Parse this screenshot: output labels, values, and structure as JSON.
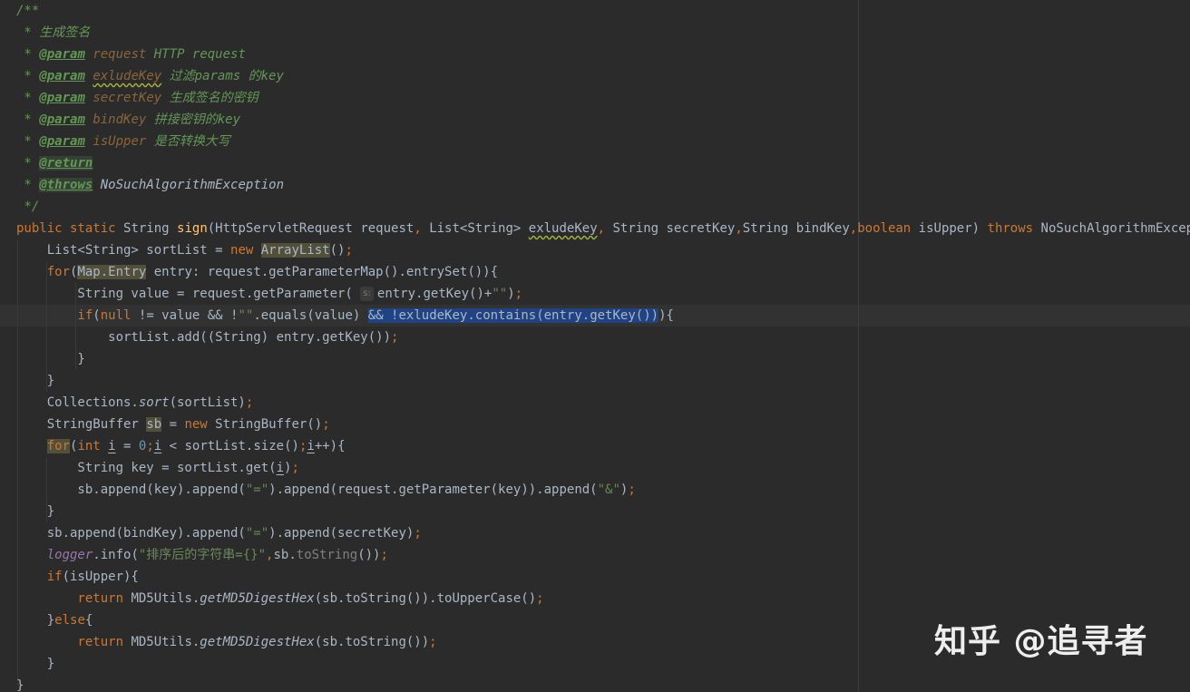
{
  "editor": {
    "language": "java",
    "colors": {
      "background": "#2b2b2b",
      "keyword": "#cc7832",
      "string": "#6a8759",
      "number": "#6897bb",
      "method": "#ffc66d",
      "doc_comment": "#629755",
      "field": "#9876aa",
      "selection": "#214283"
    },
    "lines": [
      [
        {
          "c": "doc",
          "t": "/**"
        }
      ],
      [
        {
          "c": "doc",
          "t": " * 生成签名"
        }
      ],
      [
        {
          "c": "doc",
          "t": " * "
        },
        {
          "c": "doc-tag",
          "t": "@param"
        },
        {
          "c": "doc",
          "t": " "
        },
        {
          "c": "doc-param",
          "t": "request"
        },
        {
          "c": "doc-text",
          "t": " HTTP request"
        }
      ],
      [
        {
          "c": "doc",
          "t": " * "
        },
        {
          "c": "doc-tag",
          "t": "@param"
        },
        {
          "c": "doc",
          "t": " "
        },
        {
          "c": "doc-param squiggle",
          "t": "exludeKey"
        },
        {
          "c": "doc-text",
          "t": " 过滤params 的key"
        }
      ],
      [
        {
          "c": "doc",
          "t": " * "
        },
        {
          "c": "doc-tag",
          "t": "@param"
        },
        {
          "c": "doc",
          "t": " "
        },
        {
          "c": "doc-param",
          "t": "secretKey"
        },
        {
          "c": "doc-text",
          "t": " 生成签名的密钥"
        }
      ],
      [
        {
          "c": "doc",
          "t": " * "
        },
        {
          "c": "doc-tag",
          "t": "@param"
        },
        {
          "c": "doc",
          "t": " "
        },
        {
          "c": "doc-param",
          "t": "bindKey"
        },
        {
          "c": "doc-text",
          "t": " 拼接密钥的key"
        }
      ],
      [
        {
          "c": "doc",
          "t": " * "
        },
        {
          "c": "doc-tag",
          "t": "@param"
        },
        {
          "c": "doc",
          "t": " "
        },
        {
          "c": "doc-param",
          "t": "isUpper"
        },
        {
          "c": "doc-text",
          "t": " 是否转换大写"
        }
      ],
      [
        {
          "c": "doc",
          "t": " * "
        },
        {
          "c": "doc-tag doc-tag-hl",
          "t": "@return"
        }
      ],
      [
        {
          "c": "doc",
          "t": " * "
        },
        {
          "c": "doc-tag doc-tag-hl",
          "t": "@throws"
        },
        {
          "c": "doc",
          "t": " "
        },
        {
          "c": "plain static-call",
          "t": "NoSuchAlgorithmException"
        }
      ],
      [
        {
          "c": "doc",
          "t": " */"
        }
      ],
      [
        {
          "c": "kw",
          "t": "public static "
        },
        {
          "c": "plain",
          "t": "String "
        },
        {
          "c": "fn",
          "t": "sign"
        },
        {
          "c": "plain",
          "t": "(HttpServletRequest request"
        },
        {
          "c": "kw",
          "t": ", "
        },
        {
          "c": "plain",
          "t": "List<String> "
        },
        {
          "c": "plain squiggle",
          "t": "exludeKey"
        },
        {
          "c": "kw",
          "t": ", "
        },
        {
          "c": "plain",
          "t": "String secretKey"
        },
        {
          "c": "kw",
          "t": ","
        },
        {
          "c": "plain",
          "t": "String bindKey"
        },
        {
          "c": "kw",
          "t": ",boolean "
        },
        {
          "c": "plain",
          "t": "isUpper) "
        },
        {
          "c": "kw",
          "t": "throws "
        },
        {
          "c": "plain",
          "t": "NoSuchAlgorithmException {"
        }
      ],
      [
        {
          "c": "plain",
          "t": "    List<String> sortList = "
        },
        {
          "c": "kw",
          "t": "new "
        },
        {
          "c": "plain hl-usage",
          "t": "ArrayList"
        },
        {
          "c": "plain",
          "t": "()"
        },
        {
          "c": "kw",
          "t": ";"
        }
      ],
      [
        {
          "c": "kw",
          "t": "    for"
        },
        {
          "c": "plain",
          "t": "("
        },
        {
          "c": "plain hl-usage",
          "t": "Map.Entry"
        },
        {
          "c": "plain",
          "t": " entry: request.getParameterMap().entrySet()){"
        }
      ],
      [
        {
          "c": "plain",
          "t": "        String value = request.getParameter( "
        },
        {
          "c": "hint",
          "t": "s:"
        },
        {
          "c": "plain",
          "t": "entry.getKey()+"
        },
        {
          "c": "str",
          "t": "\"\""
        },
        {
          "c": "plain",
          "t": ")"
        },
        {
          "c": "kw",
          "t": ";"
        }
      ],
      [
        {
          "c": "kw",
          "t": "        if"
        },
        {
          "c": "plain",
          "t": "("
        },
        {
          "c": "kw",
          "t": "null "
        },
        {
          "c": "plain",
          "t": "!= value && !"
        },
        {
          "c": "str",
          "t": "\"\""
        },
        {
          "c": "plain",
          "t": ".equals(value) "
        },
        {
          "c": "plain sel",
          "t": "&& !exludeKey.contains(entry.getKey())"
        },
        {
          "c": "plain",
          "t": "){"
        }
      ],
      [
        {
          "c": "plain",
          "t": "            sortList.add((String) entry.getKey())"
        },
        {
          "c": "kw",
          "t": ";"
        }
      ],
      [
        {
          "c": "plain",
          "t": "        }"
        }
      ],
      [
        {
          "c": "plain",
          "t": "    }"
        }
      ],
      [
        {
          "c": "plain",
          "t": "    Collections."
        },
        {
          "c": "plain static-call",
          "t": "sort"
        },
        {
          "c": "plain",
          "t": "(sortList)"
        },
        {
          "c": "kw",
          "t": ";"
        }
      ],
      [
        {
          "c": "plain",
          "t": "    StringBuffer "
        },
        {
          "c": "plain hl-usage",
          "t": "sb"
        },
        {
          "c": "plain",
          "t": " = "
        },
        {
          "c": "kw",
          "t": "new "
        },
        {
          "c": "plain",
          "t": "StringBuffer()"
        },
        {
          "c": "kw",
          "t": ";"
        }
      ],
      [
        {
          "c": "kw",
          "t": "    "
        },
        {
          "c": "kw hl-usage",
          "t": "for"
        },
        {
          "c": "plain",
          "t": "("
        },
        {
          "c": "kw",
          "t": "int "
        },
        {
          "c": "plain ul",
          "t": "i"
        },
        {
          "c": "plain",
          "t": " = "
        },
        {
          "c": "num",
          "t": "0"
        },
        {
          "c": "kw",
          "t": ";"
        },
        {
          "c": "plain ul",
          "t": "i"
        },
        {
          "c": "plain",
          "t": " < sortList.size()"
        },
        {
          "c": "kw",
          "t": ";"
        },
        {
          "c": "plain ul",
          "t": "i"
        },
        {
          "c": "plain",
          "t": "++){"
        }
      ],
      [
        {
          "c": "plain",
          "t": "        String key = sortList.get("
        },
        {
          "c": "plain ul",
          "t": "i"
        },
        {
          "c": "plain",
          "t": ")"
        },
        {
          "c": "kw",
          "t": ";"
        }
      ],
      [
        {
          "c": "plain",
          "t": "        sb.append(key).append("
        },
        {
          "c": "str",
          "t": "\"=\""
        },
        {
          "c": "plain",
          "t": ").append(request.getParameter(key)).append("
        },
        {
          "c": "str",
          "t": "\"&\""
        },
        {
          "c": "plain",
          "t": ")"
        },
        {
          "c": "kw",
          "t": ";"
        }
      ],
      [
        {
          "c": "plain",
          "t": "    }"
        }
      ],
      [
        {
          "c": "plain",
          "t": "    sb.append(bindKey).append("
        },
        {
          "c": "str",
          "t": "\"=\""
        },
        {
          "c": "plain",
          "t": ").append(secretKey)"
        },
        {
          "c": "kw",
          "t": ";"
        }
      ],
      [
        {
          "c": "plain",
          "t": "    "
        },
        {
          "c": "field",
          "t": "logger"
        },
        {
          "c": "plain",
          "t": ".info("
        },
        {
          "c": "str",
          "t": "\"排序后的字符串={}\""
        },
        {
          "c": "kw",
          "t": ","
        },
        {
          "c": "plain",
          "t": "sb."
        },
        {
          "c": "muted",
          "t": "toString"
        },
        {
          "c": "plain",
          "t": "())"
        },
        {
          "c": "kw",
          "t": ";"
        }
      ],
      [
        {
          "c": "kw",
          "t": "    if"
        },
        {
          "c": "plain",
          "t": "(isUpper){"
        }
      ],
      [
        {
          "c": "kw",
          "t": "        return "
        },
        {
          "c": "plain",
          "t": "MD5Utils."
        },
        {
          "c": "plain static-call",
          "t": "getMD5DigestHex"
        },
        {
          "c": "plain",
          "t": "(sb.toString()).toUpperCase()"
        },
        {
          "c": "kw",
          "t": ";"
        }
      ],
      [
        {
          "c": "plain",
          "t": "    }"
        },
        {
          "c": "kw",
          "t": "else"
        },
        {
          "c": "plain",
          "t": "{"
        }
      ],
      [
        {
          "c": "kw",
          "t": "        return "
        },
        {
          "c": "plain",
          "t": "MD5Utils."
        },
        {
          "c": "plain static-call",
          "t": "getMD5DigestHex"
        },
        {
          "c": "plain",
          "t": "(sb.toString())"
        },
        {
          "c": "kw",
          "t": ";"
        }
      ],
      [
        {
          "c": "plain",
          "t": "    }"
        }
      ],
      [
        {
          "c": "plain",
          "t": "}"
        }
      ]
    ]
  },
  "watermark": {
    "text": "知乎 @追寻者"
  }
}
